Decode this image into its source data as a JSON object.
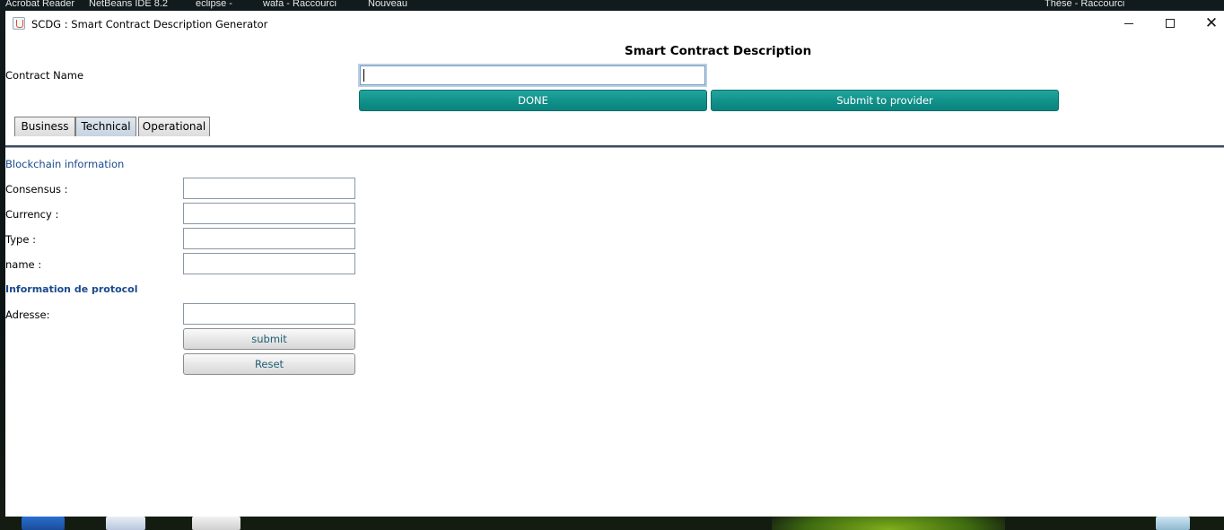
{
  "desktop": {
    "taskbar_items": [
      "Acrobat Reader",
      "NetBeans IDE 8.2",
      "eclipse -",
      "wafa - Raccourci",
      "Nouveau",
      "Thèse - Raccourci"
    ]
  },
  "window": {
    "title": "SCDG : Smart Contract Description Generator",
    "minimize_label": "—",
    "maximize_label": "☐",
    "close_label": "✕"
  },
  "header": {
    "title": "Smart Contract Description",
    "contract_name_label": "Contract Name",
    "contract_name_value": "",
    "done_button": "DONE",
    "submit_provider_button": "Submit to provider"
  },
  "tabs": [
    {
      "label": "Business",
      "active": false
    },
    {
      "label": "Technical",
      "active": true
    },
    {
      "label": "Operational",
      "active": false
    }
  ],
  "blockchain": {
    "section_title": "Blockchain information",
    "fields": [
      {
        "label": "Consensus :",
        "value": ""
      },
      {
        "label": "Currency :",
        "value": ""
      },
      {
        "label": "Type :",
        "value": ""
      },
      {
        "label": "name :",
        "value": ""
      }
    ]
  },
  "protocol": {
    "section_title": "Information de protocol",
    "address_label": "Adresse:",
    "address_value": "",
    "submit_button": "submit",
    "reset_button": "Reset"
  },
  "colors": {
    "accent_teal": "#109089",
    "section_blue": "#1a4a8c",
    "window_bg": "#ffffff"
  }
}
